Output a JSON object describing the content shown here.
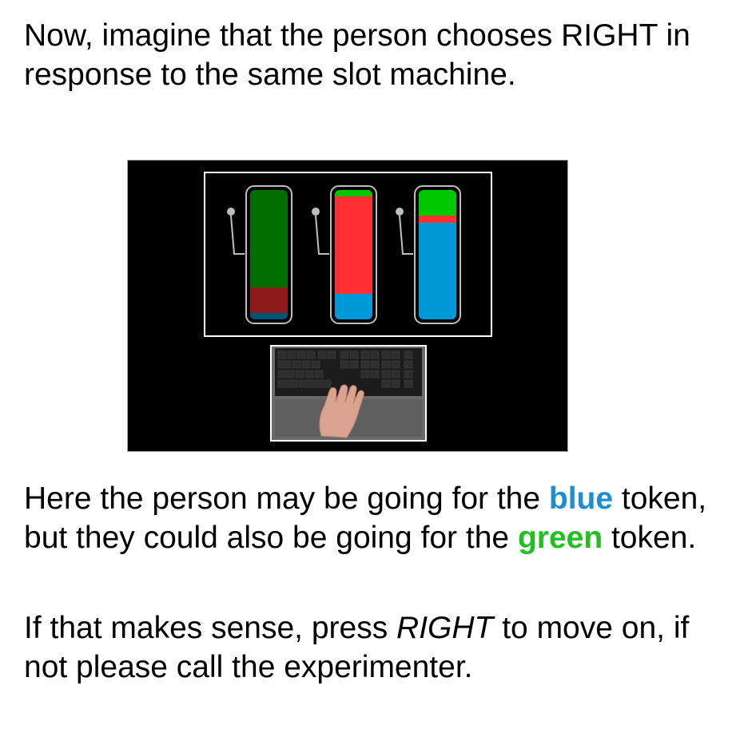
{
  "intro": "Now, imagine that the person chooses RIGHT in response to the same slot machine.",
  "para1": {
    "part1": "Here the person may be going for the ",
    "blue_word": "blue",
    "part2": " token, but they could also be going for the ",
    "green_word": "green",
    "part3": " token."
  },
  "para2": {
    "part1": "If that makes sense, press ",
    "key": "RIGHT",
    "part2": " to move on, if not please call the experimenter."
  },
  "colors": {
    "blue": "#1b8fd0",
    "green": "#1fc01f",
    "token_green": "#00c800",
    "token_red": "#ff3030",
    "token_blue": "#0099d8"
  },
  "slot_machines": [
    {
      "highlighted": false,
      "levels": {
        "green": 0.76,
        "red": 0.2,
        "blue": 0.05
      }
    },
    {
      "highlighted": false,
      "levels": {
        "green": 0.05,
        "red": 0.75,
        "blue": 0.2
      }
    },
    {
      "highlighted": true,
      "levels": {
        "green": 0.2,
        "red": 0.05,
        "blue": 0.75
      }
    }
  ],
  "keyboard_image": "keyboard-hand-image"
}
